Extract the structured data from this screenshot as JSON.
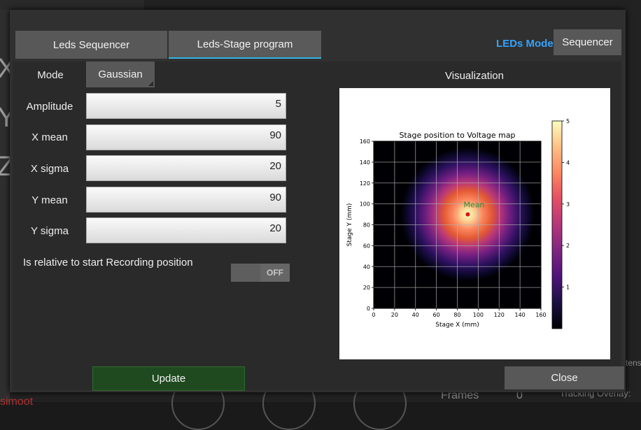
{
  "background": {
    "letters": [
      "X",
      "Y",
      "Z"
    ],
    "bottom_left": "simoot",
    "frames_label": "Frames",
    "frames_value": "0",
    "tracking_label": "Tracking Overlay:",
    "right_edge": "tens"
  },
  "tabs": [
    {
      "label": "Leds Sequencer",
      "active": false
    },
    {
      "label": "Leds-Stage program",
      "active": true
    }
  ],
  "leds_mode": {
    "label": "LEDs Mode",
    "value": "Sequencer"
  },
  "form": {
    "mode_label": "Mode",
    "mode_value": "Gaussian",
    "amplitude_label": "Amplitude",
    "amplitude_value": "5",
    "x_mean_label": "X mean",
    "x_mean_value": "90",
    "x_sigma_label": "X sigma",
    "x_sigma_value": "20",
    "y_mean_label": "Y mean",
    "y_mean_value": "90",
    "y_sigma_label": "Y sigma",
    "y_sigma_value": "20",
    "relative_label": "Is relative to start Recording position",
    "relative_toggle": "OFF"
  },
  "visualization": {
    "title": "Visualization"
  },
  "buttons": {
    "update": "Update",
    "close": "Close"
  },
  "colors": {
    "accent": "#33b5e5",
    "mode_label": "#33a3ff",
    "update_bg": "#1f4a1f"
  },
  "chart_data": {
    "type": "heatmap",
    "title": "Stage position to Voltage map",
    "xlabel": "Stage X (mm)",
    "ylabel": "Stage Y (mm)",
    "xlim": [
      0,
      160
    ],
    "ylim": [
      0,
      160
    ],
    "xticks": [
      0,
      20,
      40,
      60,
      80,
      100,
      120,
      140,
      160
    ],
    "yticks": [
      0,
      20,
      40,
      60,
      80,
      100,
      120,
      140,
      160
    ],
    "grid": true,
    "colormap": "magma",
    "function": "gaussian",
    "amplitude": 5,
    "x_mean": 90,
    "y_mean": 90,
    "x_sigma": 20,
    "y_sigma": 20,
    "colorbar_ticks": [
      1,
      2,
      3,
      4,
      5
    ],
    "annotation": {
      "text": "Mean",
      "x": 90,
      "y": 90,
      "color": "#2e8b2e"
    }
  }
}
